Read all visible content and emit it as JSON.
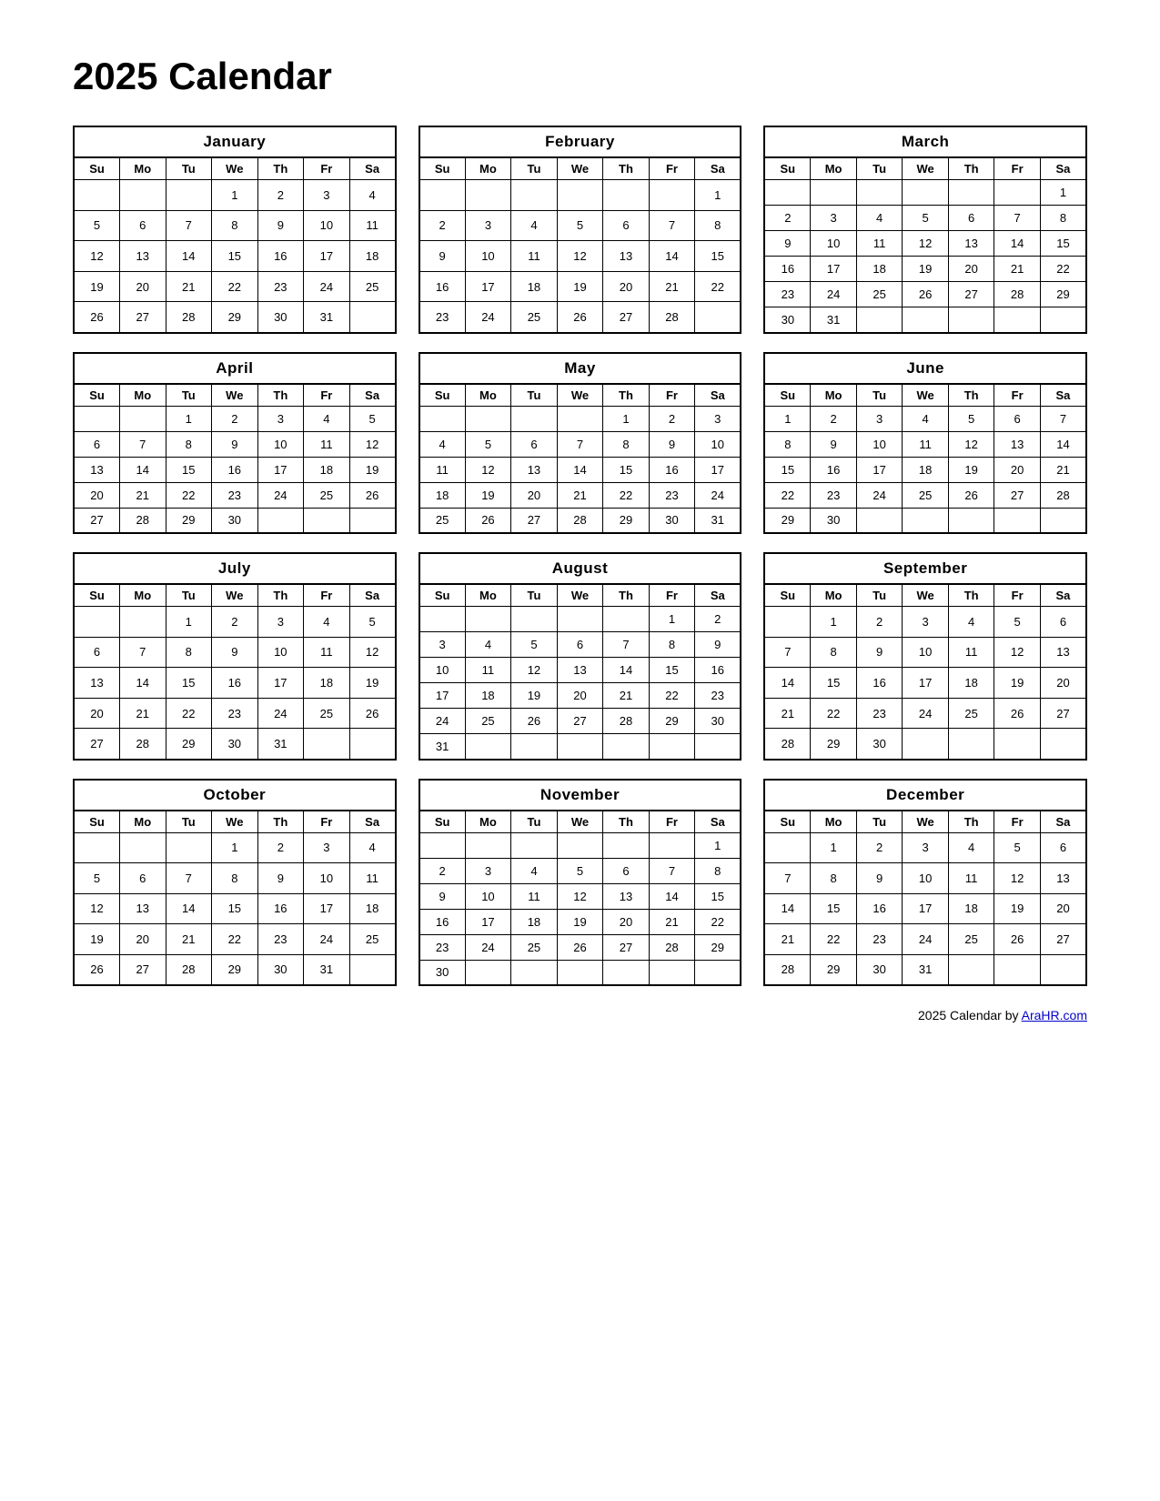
{
  "title": "2025 Calendar",
  "footer": {
    "text": "2025  Calendar by ",
    "link_text": "AraHR.com",
    "link_url": "#"
  },
  "months": [
    {
      "name": "January",
      "days": [
        "Su",
        "Mo",
        "Tu",
        "We",
        "Th",
        "Fr",
        "Sa"
      ],
      "weeks": [
        [
          "",
          "",
          "",
          "1",
          "2",
          "3",
          "4"
        ],
        [
          "5",
          "6",
          "7",
          "8",
          "9",
          "10",
          "11"
        ],
        [
          "12",
          "13",
          "14",
          "15",
          "16",
          "17",
          "18"
        ],
        [
          "19",
          "20",
          "21",
          "22",
          "23",
          "24",
          "25"
        ],
        [
          "26",
          "27",
          "28",
          "29",
          "30",
          "31",
          ""
        ]
      ]
    },
    {
      "name": "February",
      "days": [
        "Su",
        "Mo",
        "Tu",
        "We",
        "Th",
        "Fr",
        "Sa"
      ],
      "weeks": [
        [
          "",
          "",
          "",
          "",
          "",
          "",
          "1"
        ],
        [
          "2",
          "3",
          "4",
          "5",
          "6",
          "7",
          "8"
        ],
        [
          "9",
          "10",
          "11",
          "12",
          "13",
          "14",
          "15"
        ],
        [
          "16",
          "17",
          "18",
          "19",
          "20",
          "21",
          "22"
        ],
        [
          "23",
          "24",
          "25",
          "26",
          "27",
          "28",
          ""
        ]
      ]
    },
    {
      "name": "March",
      "days": [
        "Su",
        "Mo",
        "Tu",
        "We",
        "Th",
        "Fr",
        "Sa"
      ],
      "weeks": [
        [
          "",
          "",
          "",
          "",
          "",
          "",
          "1"
        ],
        [
          "2",
          "3",
          "4",
          "5",
          "6",
          "7",
          "8"
        ],
        [
          "9",
          "10",
          "11",
          "12",
          "13",
          "14",
          "15"
        ],
        [
          "16",
          "17",
          "18",
          "19",
          "20",
          "21",
          "22"
        ],
        [
          "23",
          "24",
          "25",
          "26",
          "27",
          "28",
          "29"
        ],
        [
          "30",
          "31",
          "",
          "",
          "",
          "",
          ""
        ]
      ]
    },
    {
      "name": "April",
      "days": [
        "Su",
        "Mo",
        "Tu",
        "We",
        "Th",
        "Fr",
        "Sa"
      ],
      "weeks": [
        [
          "",
          "",
          "1",
          "2",
          "3",
          "4",
          "5"
        ],
        [
          "6",
          "7",
          "8",
          "9",
          "10",
          "11",
          "12"
        ],
        [
          "13",
          "14",
          "15",
          "16",
          "17",
          "18",
          "19"
        ],
        [
          "20",
          "21",
          "22",
          "23",
          "24",
          "25",
          "26"
        ],
        [
          "27",
          "28",
          "29",
          "30",
          "",
          "",
          ""
        ]
      ]
    },
    {
      "name": "May",
      "days": [
        "Su",
        "Mo",
        "Tu",
        "We",
        "Th",
        "Fr",
        "Sa"
      ],
      "weeks": [
        [
          "",
          "",
          "",
          "",
          "1",
          "2",
          "3"
        ],
        [
          "4",
          "5",
          "6",
          "7",
          "8",
          "9",
          "10"
        ],
        [
          "11",
          "12",
          "13",
          "14",
          "15",
          "16",
          "17"
        ],
        [
          "18",
          "19",
          "20",
          "21",
          "22",
          "23",
          "24"
        ],
        [
          "25",
          "26",
          "27",
          "28",
          "29",
          "30",
          "31"
        ]
      ]
    },
    {
      "name": "June",
      "days": [
        "Su",
        "Mo",
        "Tu",
        "We",
        "Th",
        "Fr",
        "Sa"
      ],
      "weeks": [
        [
          "1",
          "2",
          "3",
          "4",
          "5",
          "6",
          "7"
        ],
        [
          "8",
          "9",
          "10",
          "11",
          "12",
          "13",
          "14"
        ],
        [
          "15",
          "16",
          "17",
          "18",
          "19",
          "20",
          "21"
        ],
        [
          "22",
          "23",
          "24",
          "25",
          "26",
          "27",
          "28"
        ],
        [
          "29",
          "30",
          "",
          "",
          "",
          "",
          ""
        ]
      ]
    },
    {
      "name": "July",
      "days": [
        "Su",
        "Mo",
        "Tu",
        "We",
        "Th",
        "Fr",
        "Sa"
      ],
      "weeks": [
        [
          "",
          "",
          "1",
          "2",
          "3",
          "4",
          "5"
        ],
        [
          "6",
          "7",
          "8",
          "9",
          "10",
          "11",
          "12"
        ],
        [
          "13",
          "14",
          "15",
          "16",
          "17",
          "18",
          "19"
        ],
        [
          "20",
          "21",
          "22",
          "23",
          "24",
          "25",
          "26"
        ],
        [
          "27",
          "28",
          "29",
          "30",
          "31",
          "",
          ""
        ]
      ]
    },
    {
      "name": "August",
      "days": [
        "Su",
        "Mo",
        "Tu",
        "We",
        "Th",
        "Fr",
        "Sa"
      ],
      "weeks": [
        [
          "",
          "",
          "",
          "",
          "",
          "1",
          "2"
        ],
        [
          "3",
          "4",
          "5",
          "6",
          "7",
          "8",
          "9"
        ],
        [
          "10",
          "11",
          "12",
          "13",
          "14",
          "15",
          "16"
        ],
        [
          "17",
          "18",
          "19",
          "20",
          "21",
          "22",
          "23"
        ],
        [
          "24",
          "25",
          "26",
          "27",
          "28",
          "29",
          "30"
        ],
        [
          "31",
          "",
          "",
          "",
          "",
          "",
          ""
        ]
      ]
    },
    {
      "name": "September",
      "days": [
        "Su",
        "Mo",
        "Tu",
        "We",
        "Th",
        "Fr",
        "Sa"
      ],
      "weeks": [
        [
          "",
          "1",
          "2",
          "3",
          "4",
          "5",
          "6"
        ],
        [
          "7",
          "8",
          "9",
          "10",
          "11",
          "12",
          "13"
        ],
        [
          "14",
          "15",
          "16",
          "17",
          "18",
          "19",
          "20"
        ],
        [
          "21",
          "22",
          "23",
          "24",
          "25",
          "26",
          "27"
        ],
        [
          "28",
          "29",
          "30",
          "",
          "",
          "",
          ""
        ]
      ]
    },
    {
      "name": "October",
      "days": [
        "Su",
        "Mo",
        "Tu",
        "We",
        "Th",
        "Fr",
        "Sa"
      ],
      "weeks": [
        [
          "",
          "",
          "",
          "1",
          "2",
          "3",
          "4"
        ],
        [
          "5",
          "6",
          "7",
          "8",
          "9",
          "10",
          "11"
        ],
        [
          "12",
          "13",
          "14",
          "15",
          "16",
          "17",
          "18"
        ],
        [
          "19",
          "20",
          "21",
          "22",
          "23",
          "24",
          "25"
        ],
        [
          "26",
          "27",
          "28",
          "29",
          "30",
          "31",
          ""
        ]
      ]
    },
    {
      "name": "November",
      "days": [
        "Su",
        "Mo",
        "Tu",
        "We",
        "Th",
        "Fr",
        "Sa"
      ],
      "weeks": [
        [
          "",
          "",
          "",
          "",
          "",
          "",
          "1"
        ],
        [
          "2",
          "3",
          "4",
          "5",
          "6",
          "7",
          "8"
        ],
        [
          "9",
          "10",
          "11",
          "12",
          "13",
          "14",
          "15"
        ],
        [
          "16",
          "17",
          "18",
          "19",
          "20",
          "21",
          "22"
        ],
        [
          "23",
          "24",
          "25",
          "26",
          "27",
          "28",
          "29"
        ],
        [
          "30",
          "",
          "",
          "",
          "",
          "",
          ""
        ]
      ]
    },
    {
      "name": "December",
      "days": [
        "Su",
        "Mo",
        "Tu",
        "We",
        "Th",
        "Fr",
        "Sa"
      ],
      "weeks": [
        [
          "",
          "1",
          "2",
          "3",
          "4",
          "5",
          "6"
        ],
        [
          "7",
          "8",
          "9",
          "10",
          "11",
          "12",
          "13"
        ],
        [
          "14",
          "15",
          "16",
          "17",
          "18",
          "19",
          "20"
        ],
        [
          "21",
          "22",
          "23",
          "24",
          "25",
          "26",
          "27"
        ],
        [
          "28",
          "29",
          "30",
          "31",
          "",
          "",
          ""
        ]
      ]
    }
  ]
}
